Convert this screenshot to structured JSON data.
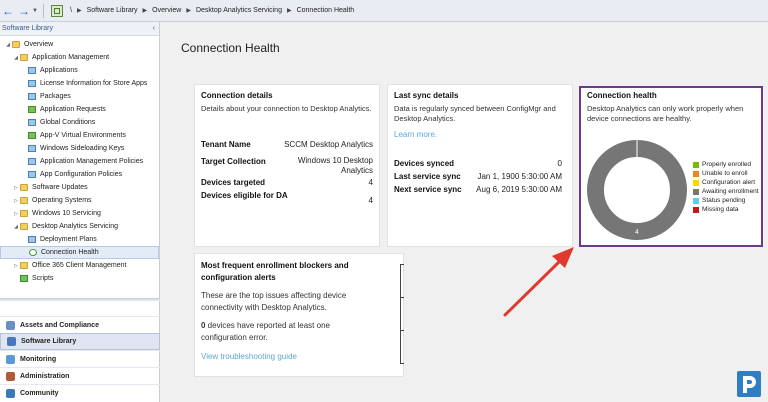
{
  "nav": {
    "breadcrumb": [
      "\\",
      "Software Library",
      "Overview",
      "Desktop Analytics Servicing",
      "Connection Health"
    ]
  },
  "left_pane": {
    "title": "Software Library",
    "collapse_glyph": "‹",
    "tree": [
      {
        "label": "Overview",
        "indent": 0,
        "expander": "◢",
        "icon": "folder"
      },
      {
        "label": "Application Management",
        "indent": 1,
        "expander": "◢",
        "icon": "folder"
      },
      {
        "label": "Applications",
        "indent": 2,
        "expander": "",
        "icon": "app"
      },
      {
        "label": "License Information for Store Apps",
        "indent": 2,
        "expander": "",
        "icon": "app"
      },
      {
        "label": "Packages",
        "indent": 2,
        "expander": "",
        "icon": "app"
      },
      {
        "label": "Application Requests",
        "indent": 2,
        "expander": "",
        "icon": "green"
      },
      {
        "label": "Global Conditions",
        "indent": 2,
        "expander": "",
        "icon": "app"
      },
      {
        "label": "App-V Virtual Environments",
        "indent": 2,
        "expander": "",
        "icon": "green"
      },
      {
        "label": "Windows Sideloading Keys",
        "indent": 2,
        "expander": "",
        "icon": "app"
      },
      {
        "label": "Application Management Policies",
        "indent": 2,
        "expander": "",
        "icon": "app"
      },
      {
        "label": "App Configuration Policies",
        "indent": 2,
        "expander": "",
        "icon": "app"
      },
      {
        "label": "Software Updates",
        "indent": 1,
        "expander": "▷",
        "icon": "folder"
      },
      {
        "label": "Operating Systems",
        "indent": 1,
        "expander": "▷",
        "icon": "folder"
      },
      {
        "label": "Windows 10 Servicing",
        "indent": 1,
        "expander": "▷",
        "icon": "folder"
      },
      {
        "label": "Desktop Analytics Servicing",
        "indent": 1,
        "expander": "◢",
        "icon": "folder"
      },
      {
        "label": "Deployment Plans",
        "indent": 2,
        "expander": "",
        "icon": "app"
      },
      {
        "label": "Connection Health",
        "indent": 2,
        "expander": "",
        "icon": "sync",
        "selected": true
      },
      {
        "label": "Office 365 Client Management",
        "indent": 1,
        "expander": "▷",
        "icon": "folder"
      },
      {
        "label": "Scripts",
        "indent": 1,
        "expander": "",
        "icon": "arrow"
      }
    ],
    "workspaces": [
      {
        "label": "Assets and Compliance",
        "color": "#6b8fc4"
      },
      {
        "label": "Software Library",
        "color": "#4a78b8",
        "active": true
      },
      {
        "label": "Monitoring",
        "color": "#5b9bd5"
      },
      {
        "label": "Administration",
        "color": "#b35a3a"
      },
      {
        "label": "Community",
        "color": "#3a7ab8"
      }
    ]
  },
  "main": {
    "title": "Connection Health",
    "connection_details": {
      "title": "Connection details",
      "description": "Details about your connection to Desktop Analytics.",
      "tenant_label": "Tenant Name",
      "tenant_value": "SCCM Desktop Analytics",
      "collection_label": "Target Collection",
      "collection_value": "Windows 10 Desktop Analytics",
      "targeted_label": "Devices targeted",
      "targeted_value": "4",
      "eligible_label": "Devices eligible for DA",
      "eligible_value": "4"
    },
    "last_sync": {
      "title": "Last sync details",
      "description": "Data is regularly synced between ConfigMgr and Desktop Analytics.",
      "learn_more": "Learn more.",
      "synced_label": "Devices synced",
      "synced_value": "0",
      "last_label": "Last service sync",
      "last_value": "Jan 1, 1900 5:30:00 AM",
      "next_label": "Next service sync",
      "next_value": "Aug 6, 2019 5:30:00 AM"
    },
    "connection_health": {
      "title": "Connection health",
      "description": "Desktop Analytics can only work properly when device connections are healthy.",
      "chart_label": "4"
    },
    "blockers": {
      "title": "Most frequent enrollment blockers and configuration alerts",
      "description": "These are the top issues affecting device connectivity with Desktop Analytics.",
      "count": "0",
      "count_text": " devices have reported at least one configuration error.",
      "link": "View troubleshooting guide"
    }
  },
  "chart_data": {
    "type": "pie",
    "categories": [
      "Properly enrolled",
      "Unable to enroll",
      "Configuration alert",
      "Awaiting enrollment",
      "Status pending",
      "Missing data"
    ],
    "colors": [
      "#7fba00",
      "#f58220",
      "#ffd700",
      "#767676",
      "#5ecfe8",
      "#c21a1a"
    ],
    "values": [
      0,
      0,
      0,
      4,
      0,
      0
    ],
    "legend": "right",
    "donut": true
  }
}
